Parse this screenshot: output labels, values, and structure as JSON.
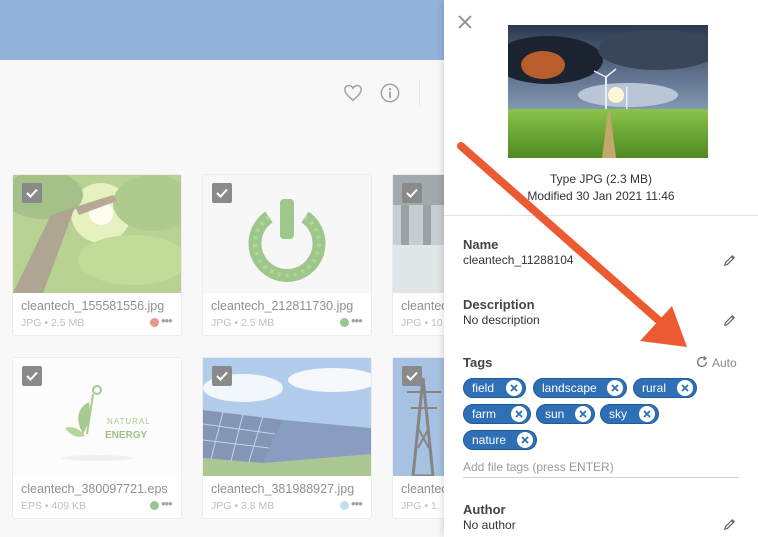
{
  "colors": {
    "accent": "#3b75bd",
    "tag": "#2e6fb5",
    "arrow": "#ec5a31"
  },
  "grid": {
    "files": [
      {
        "name": "cleantech_155581556.jpg",
        "meta": "JPG • 2.5 MB",
        "dot": "#d8413a",
        "icon": "forest-sun"
      },
      {
        "name": "cleantech_212811730.jpg",
        "meta": "JPG • 2.5 MB",
        "dot": "#3c9a3c",
        "icon": "power-leaf"
      },
      {
        "name": "cleantec",
        "meta": "JPG • 10",
        "dot": "",
        "icon": "dam"
      },
      {
        "name": "cleantech_380097721.eps",
        "meta": "EPS • 409 KB",
        "dot": "#3c9a3c",
        "icon": "natural-energy-logo",
        "logo_text": [
          "NATURAL",
          "ENERGY"
        ]
      },
      {
        "name": "cleantech_381988927.jpg",
        "meta": "JPG • 3.8 MB",
        "dot": "#8ec7df",
        "icon": "solar-panels"
      },
      {
        "name": "cleantec",
        "meta": "JPG • 1.",
        "dot": "",
        "icon": "power-pylon"
      }
    ]
  },
  "panel": {
    "type_line": "Type JPG (2.3 MB)",
    "modified_line": "Modified 30 Jan 2021 11:46",
    "name_label": "Name",
    "name_value": "cleantech_11288104",
    "description_label": "Description",
    "description_value": "No description",
    "tags_label": "Tags",
    "auto_label": "Auto",
    "tags": [
      "field",
      "landscape",
      "rural",
      "farm",
      "sun",
      "sky",
      "nature"
    ],
    "tag_input_placeholder": "Add file tags (press ENTER)",
    "author_label": "Author",
    "author_value": "No author"
  },
  "icons": {
    "close": "close-icon",
    "edit": "pencil-icon",
    "refresh": "refresh-icon",
    "remove_tag": "remove-tag-icon",
    "favorite": "heart-icon",
    "info": "info-icon"
  }
}
